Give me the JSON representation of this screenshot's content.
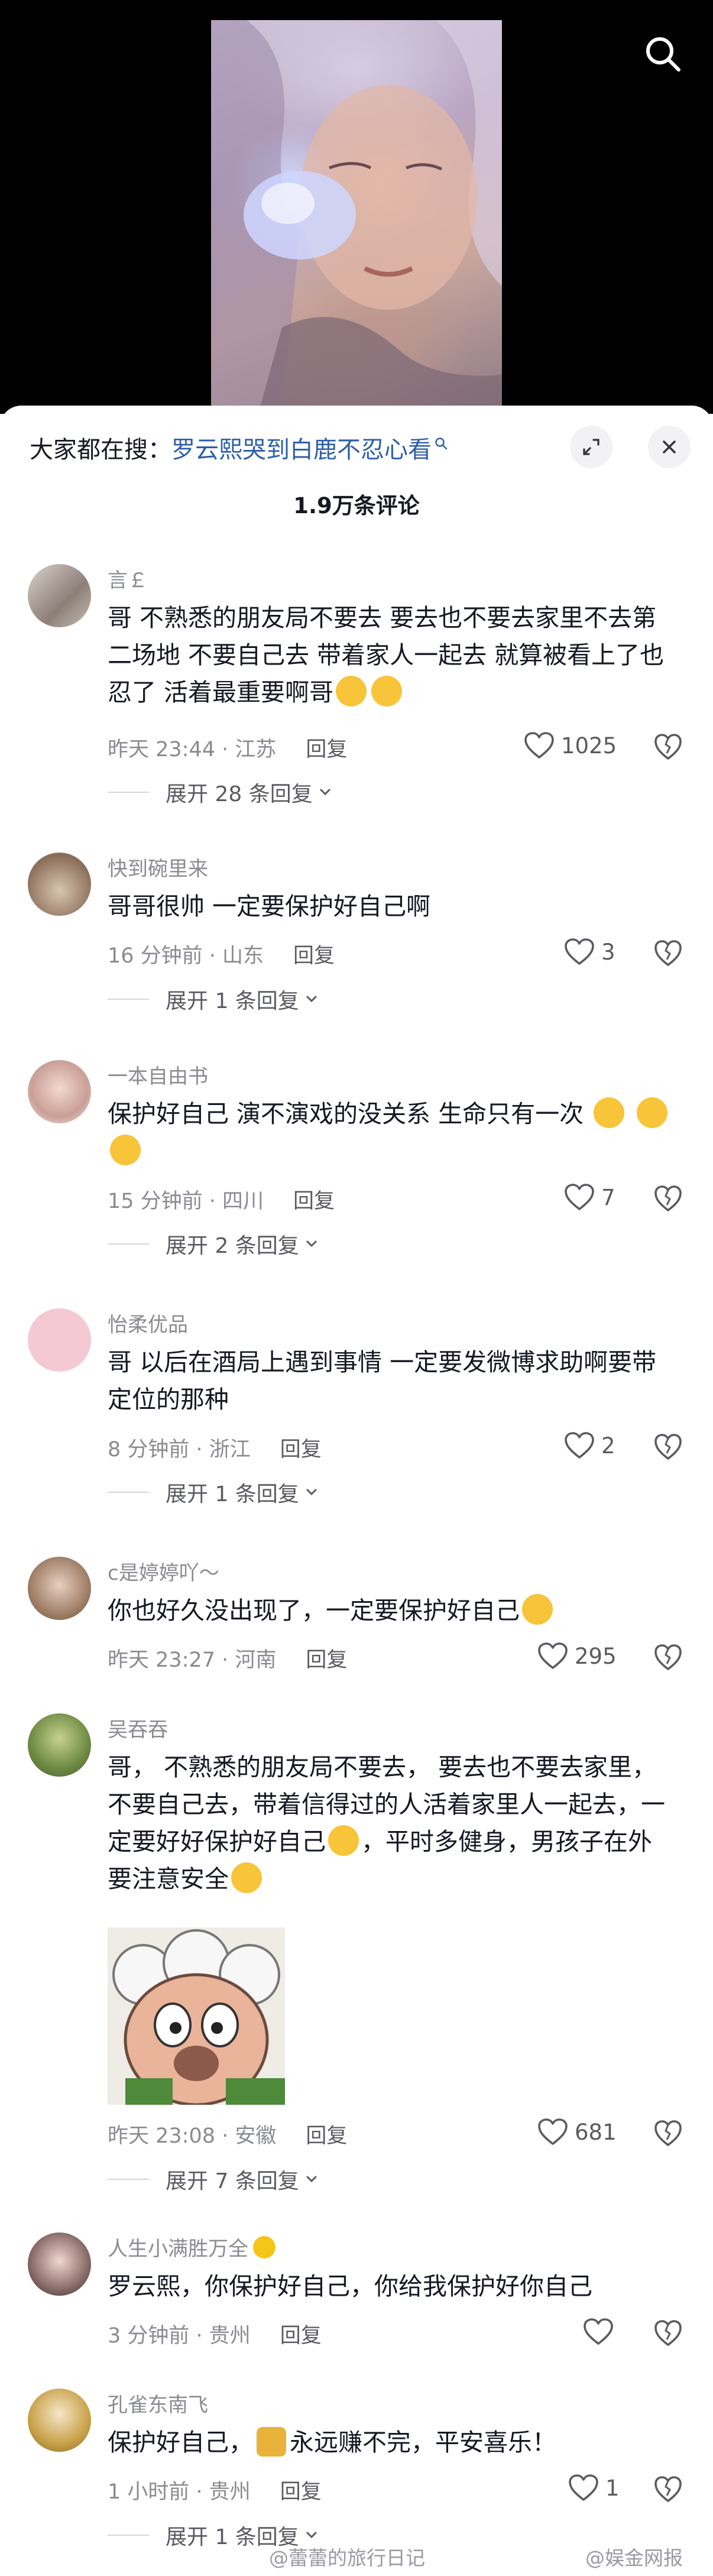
{
  "hot_search": {
    "prefix": "大家都在搜：",
    "term": "罗云熙哭到白鹿不忍心看"
  },
  "comment_count": "1.9万条评论",
  "colors": {
    "link_blue": "#2d5fa8",
    "meta_grey": "#8a8b91",
    "text": "#161823"
  },
  "icons": {
    "video_search": "search-icon",
    "shrink": "collapse-icon",
    "close": "close-icon",
    "like": "heart-icon",
    "dislike": "broken-heart-icon"
  },
  "comments": [
    {
      "user": "言￡",
      "text": "哥 不熟悉的朋友局不要去 要去也不要去家里不去第二场地 不要自己去 带着家人一起去 就算被看上了也忍了 活着最重要啊哥",
      "time_loc": "昨天 23:44 · 江苏",
      "reply": "回复",
      "likes": "1025",
      "expand": "展开 28 条回复"
    },
    {
      "user": "快到碗里来",
      "text": "哥哥很帅 一定要保护好自己啊",
      "time_loc": "16 分钟前 · 山东",
      "reply": "回复",
      "likes": "3",
      "expand": "展开 1 条回复"
    },
    {
      "user": "一本自由书",
      "text": "保护好自己 演不演戏的没关系 生命只有一次",
      "time_loc": "15 分钟前 · 四川",
      "reply": "回复",
      "likes": "7",
      "expand": "展开 2 条回复"
    },
    {
      "user": "怡柔优品",
      "text": "哥 以后在酒局上遇到事情 一定要发微博求助啊要带定位的那种",
      "time_loc": "8 分钟前 · 浙江",
      "reply": "回复",
      "likes": "2",
      "expand": "展开 1 条回复"
    },
    {
      "user": "c是婷婷吖～",
      "text": "你也好久没出现了，一定要保护好自己",
      "time_loc": "昨天 23:27 · 河南",
      "reply": "回复",
      "likes": "295"
    },
    {
      "user": "吴吞吞",
      "text_a": "哥， 不熟悉的朋友局不要去， 要去也不要去家里， 不要自己去，带着信得过的人活着家里人一起去，一定要好好保护好自己",
      "text_b": "，平时多健身，男孩子在外要注意安全",
      "time_loc": "昨天 23:08 · 安徽",
      "reply": "回复",
      "likes": "681",
      "expand": "展开 7 条回复"
    },
    {
      "user": "人生小满胜万全",
      "text": "罗云熙，你保护好自己，你给我保护好你自己",
      "time_loc": "3 分钟前 · 贵州",
      "reply": "回复"
    },
    {
      "user": "孔雀东南飞",
      "text_a": "保护好自己，",
      "text_b": "永远赚不完，平安喜乐！",
      "time_loc": "1 小时前 · 贵州",
      "reply": "回复",
      "likes": "1",
      "expand": "展开 1 条回复"
    }
  ],
  "watermarks": [
    "@蕾蕾的旅行日记",
    "@娱金网报"
  ]
}
